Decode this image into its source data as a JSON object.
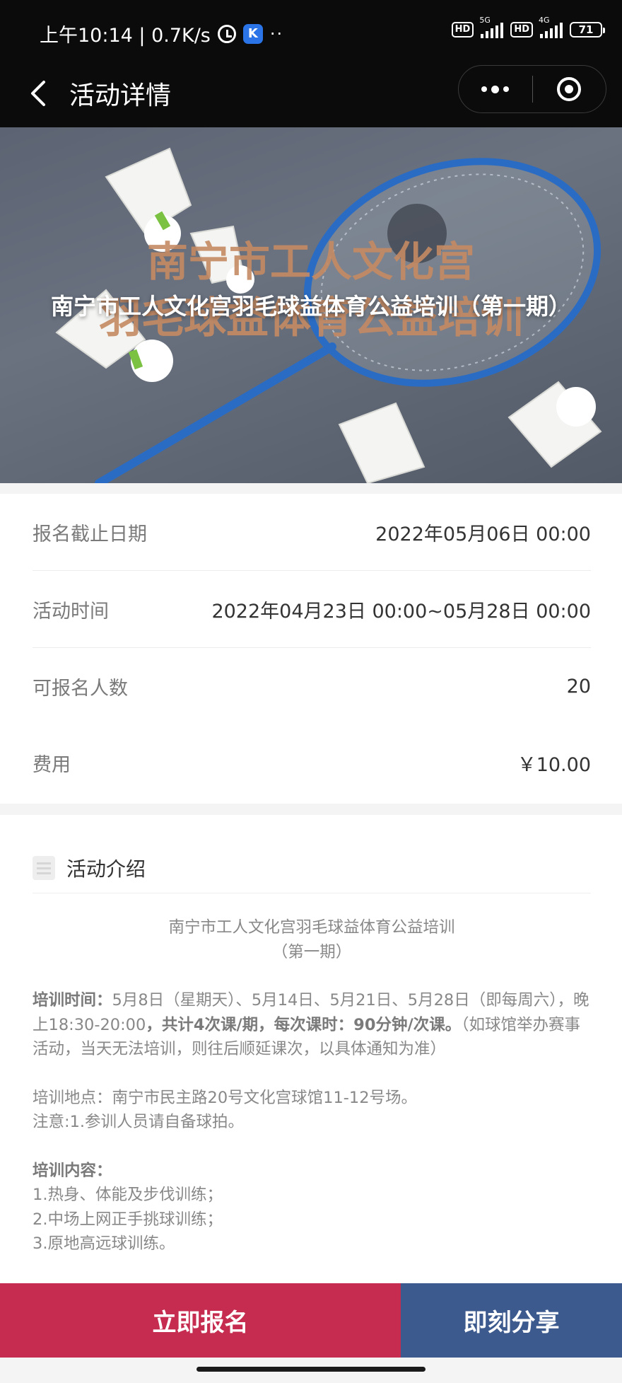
{
  "status_bar": {
    "time_speed": "上午10:14 | 0.7K/s",
    "k_badge": "K",
    "dots": "··",
    "hd1": "HD",
    "net1": "5G",
    "hd2": "HD",
    "net2": "4G",
    "battery": "71"
  },
  "nav": {
    "title": "活动详情"
  },
  "banner": {
    "title": "南宁市工人文化宫羽毛球益体育公益培训（第一期）",
    "overlay_line1": "南宁市工人文化宫",
    "overlay_line2": "羽毛球益体育公益培训"
  },
  "info": [
    {
      "label": "报名截止日期",
      "value": "2022年05月06日 00:00"
    },
    {
      "label": "活动时间",
      "value": "2022年04月23日 00:00~05月28日 00:00"
    },
    {
      "label": "可报名人数",
      "value": "20"
    },
    {
      "label": "费用",
      "value": "￥10.00"
    }
  ],
  "intro": {
    "title": "活动介绍",
    "heading_line1": "南宁市工人文化宫羽毛球益体育公益培训",
    "heading_line2": "（第一期）",
    "time_label": "培训时间：",
    "time_text1": "5月8日（星期天）、5月14日、5月21日、5月28日（即每周六），晚上18:30-20:00",
    "time_bold": "，共计4次课/期，每次课时：90分钟/次课。",
    "time_text2": "（如球馆举办赛事活动，当天无法培训，则往后顺延课次，以具体通知为准）",
    "location": "培训地点：南宁市民主路20号文化宫球馆11-12号场。",
    "note": "注意:1.参训人员请自备球拍。",
    "content_label": "培训内容：",
    "content_items": [
      "1.热身、体能及步伐训练；",
      "2.中场上网正手挑球训练；",
      "3.原地高远球训练。"
    ]
  },
  "buttons": {
    "signup": "立即报名",
    "share": "即刻分享"
  }
}
